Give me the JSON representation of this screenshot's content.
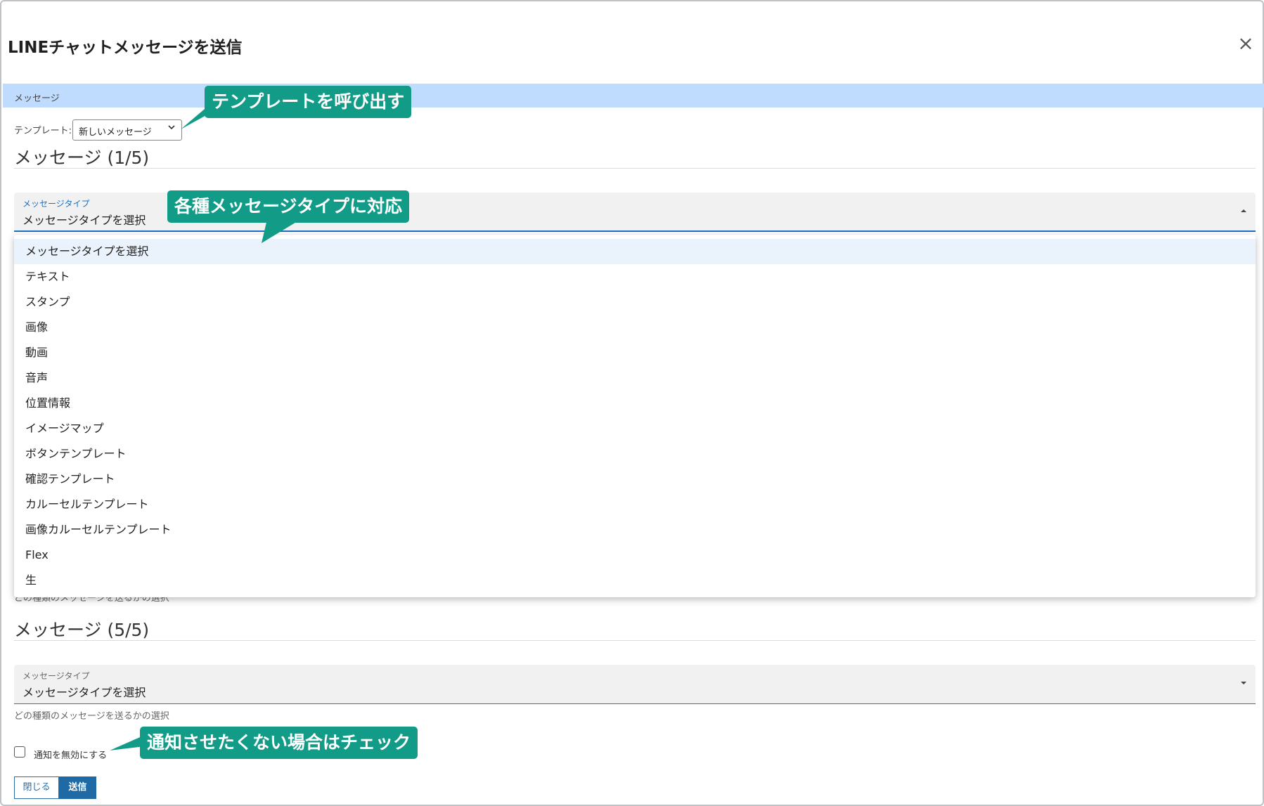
{
  "modal": {
    "title": "LINEチャットメッセージを送信",
    "close_glyph": "×"
  },
  "section": {
    "label": "メッセージ"
  },
  "template": {
    "label": "テンプレート:",
    "selected": "新しいメッセージ"
  },
  "message1": {
    "heading": "メッセージ (1/5)",
    "type_label": "メッセージタイプ",
    "type_value": "メッセージタイプを選択",
    "helper": "どの種類のメッセージを送るかの選択"
  },
  "dropdown": {
    "options": [
      "メッセージタイプを選択",
      "テキスト",
      "スタンプ",
      "画像",
      "動画",
      "音声",
      "位置情報",
      "イメージマップ",
      "ボタンテンプレート",
      "確認テンプレート",
      "カルーセルテンプレート",
      "画像カルーセルテンプレート",
      "Flex",
      "生"
    ],
    "selected_index": 0
  },
  "message5": {
    "heading": "メッセージ (5/5)",
    "type_label": "メッセージタイプ",
    "type_value": "メッセージタイプを選択",
    "helper": "どの種類のメッセージを送るかの選択"
  },
  "notify": {
    "label": "通知を無効にする",
    "checked": false
  },
  "buttons": {
    "close": "閉じる",
    "send": "送信"
  },
  "callouts": {
    "template": "テンプレートを呼び出す",
    "types": "各種メッセージタイプに対応",
    "notify": "通知させたくない場合はチェック"
  },
  "icons": {
    "close": "close-icon",
    "chevron": "chevron-down-icon",
    "arrow_up": "arrow-up-icon",
    "arrow_down": "arrow-down-icon"
  },
  "colors": {
    "band": "#bfdbfd",
    "accent": "#1e6fc0",
    "callout": "#129c88",
    "send_button": "#1f6aa5"
  }
}
